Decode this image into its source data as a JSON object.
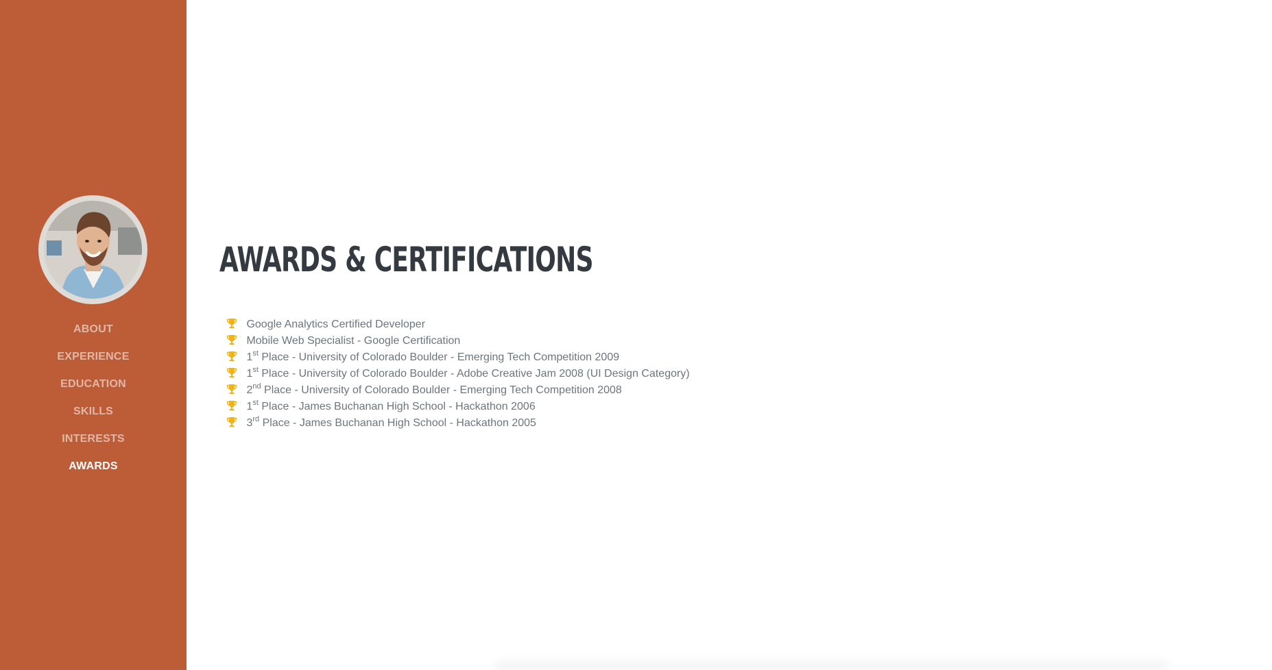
{
  "nav": {
    "items": [
      {
        "label": "ABOUT"
      },
      {
        "label": "EXPERIENCE"
      },
      {
        "label": "EDUCATION"
      },
      {
        "label": "SKILLS"
      },
      {
        "label": "INTERESTS"
      },
      {
        "label": "AWARDS",
        "active": true
      }
    ]
  },
  "section": {
    "title": "AWARDS & CERTIFICATIONS"
  },
  "awards": [
    {
      "prefix": "",
      "sup": "",
      "text": "Google Analytics Certified Developer"
    },
    {
      "prefix": "",
      "sup": "",
      "text": "Mobile Web Specialist - Google Certification"
    },
    {
      "prefix": "1",
      "sup": "st",
      "text": " Place - University of Colorado Boulder - Emerging Tech Competition 2009"
    },
    {
      "prefix": "1",
      "sup": "st",
      "text": " Place - University of Colorado Boulder - Adobe Creative Jam 2008 (UI Design Category)"
    },
    {
      "prefix": "2",
      "sup": "nd",
      "text": " Place - University of Colorado Boulder - Emerging Tech Competition 2008"
    },
    {
      "prefix": "1",
      "sup": "st",
      "text": " Place - James Buchanan High School - Hackathon 2006"
    },
    {
      "prefix": "3",
      "sup": "rd",
      "text": " Place - James Buchanan High School - Hackathon 2005"
    }
  ],
  "icons": {
    "award": "trophy-icon"
  },
  "colors": {
    "sidebar": "#bd5d38",
    "heading": "#343a40",
    "body_text": "#6c757d",
    "trophy": "#f3b315"
  }
}
